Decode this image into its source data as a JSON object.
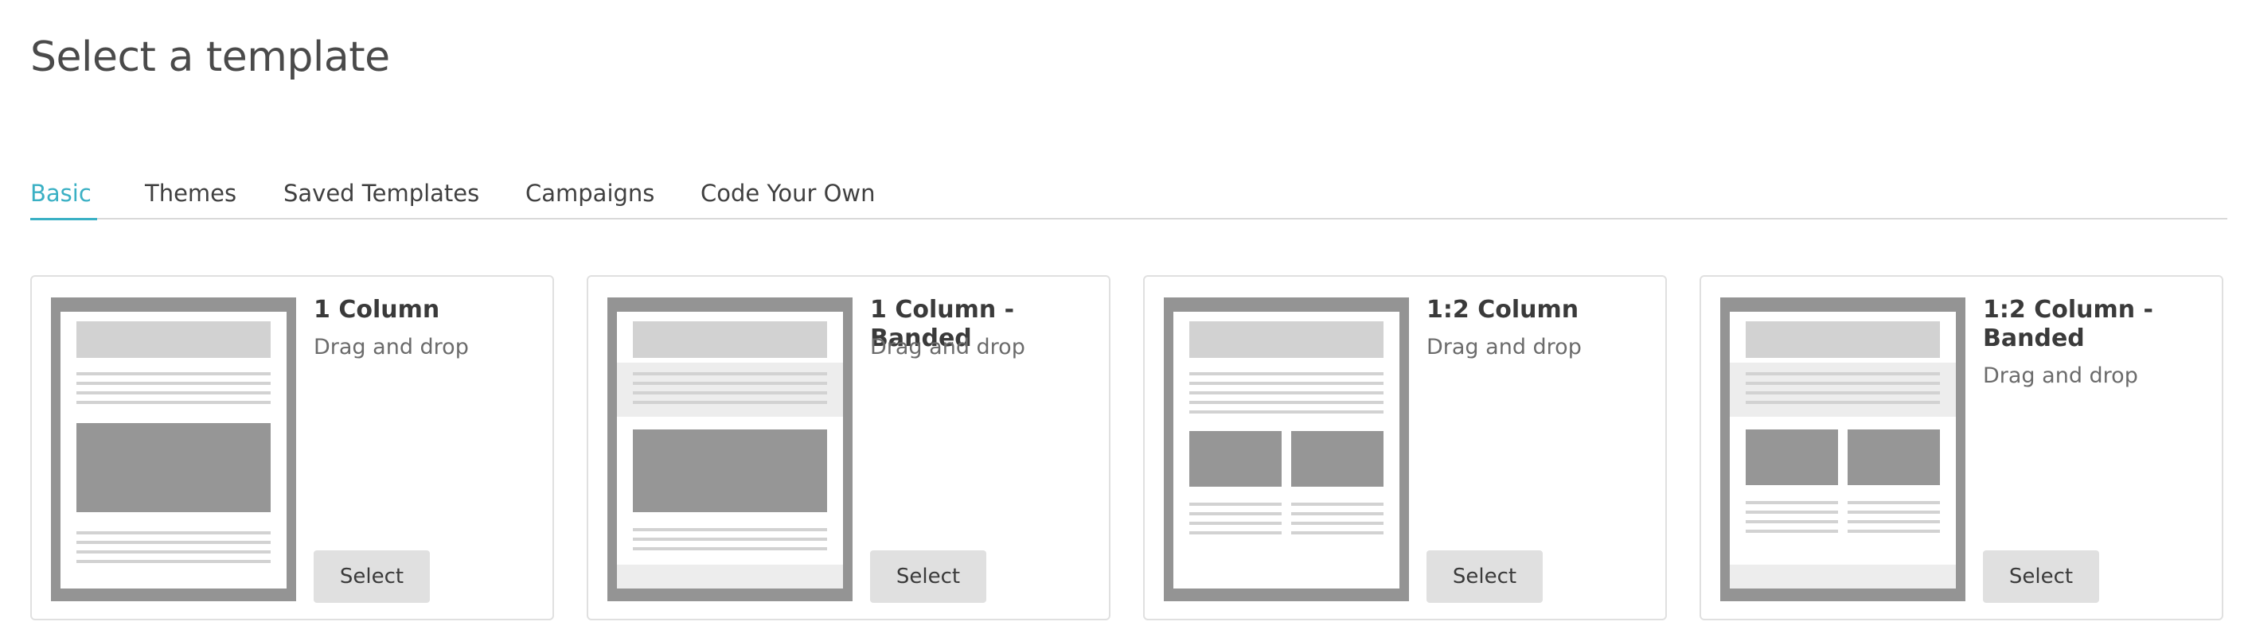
{
  "page": {
    "title": "Select a template"
  },
  "tabs": [
    {
      "label": "Basic",
      "active": true
    },
    {
      "label": "Themes",
      "active": false
    },
    {
      "label": "Saved Templates",
      "active": false
    },
    {
      "label": "Campaigns",
      "active": false
    },
    {
      "label": "Code Your Own",
      "active": false
    }
  ],
  "templates": [
    {
      "title": "1 Column",
      "subtitle": "Drag and drop",
      "button_label": "Select"
    },
    {
      "title": "1 Column - Banded",
      "subtitle": "Drag and drop",
      "button_label": "Select"
    },
    {
      "title": "1:2 Column",
      "subtitle": "Drag and drop",
      "button_label": "Select"
    },
    {
      "title": "1:2 Column - Banded",
      "subtitle": "Drag and drop",
      "button_label": "Select"
    }
  ],
  "colors": {
    "accent": "#3ab0c4",
    "thumbnail_frame": "#949494",
    "button_bg": "#e0e0e0"
  }
}
